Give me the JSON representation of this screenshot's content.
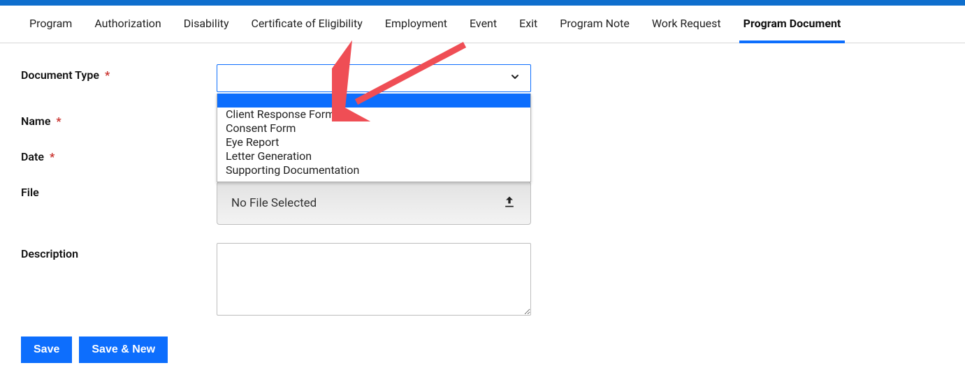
{
  "tabs": [
    {
      "label": "Program"
    },
    {
      "label": "Authorization"
    },
    {
      "label": "Disability"
    },
    {
      "label": "Certificate of Eligibility"
    },
    {
      "label": "Employment"
    },
    {
      "label": "Event"
    },
    {
      "label": "Exit"
    },
    {
      "label": "Program Note"
    },
    {
      "label": "Work Request"
    },
    {
      "label": "Program Document",
      "active": true
    }
  ],
  "form": {
    "document_type": {
      "label": "Document Type",
      "required": true,
      "options": [
        "Client Response Form",
        "Consent Form",
        "Eye Report",
        "Letter Generation",
        "Supporting Documentation"
      ]
    },
    "name": {
      "label": "Name",
      "required": true
    },
    "date": {
      "label": "Date",
      "required": true
    },
    "file": {
      "label": "File",
      "placeholder": "No File Selected"
    },
    "description": {
      "label": "Description"
    }
  },
  "buttons": {
    "save": "Save",
    "save_new": "Save & New"
  },
  "required_marker": "*"
}
